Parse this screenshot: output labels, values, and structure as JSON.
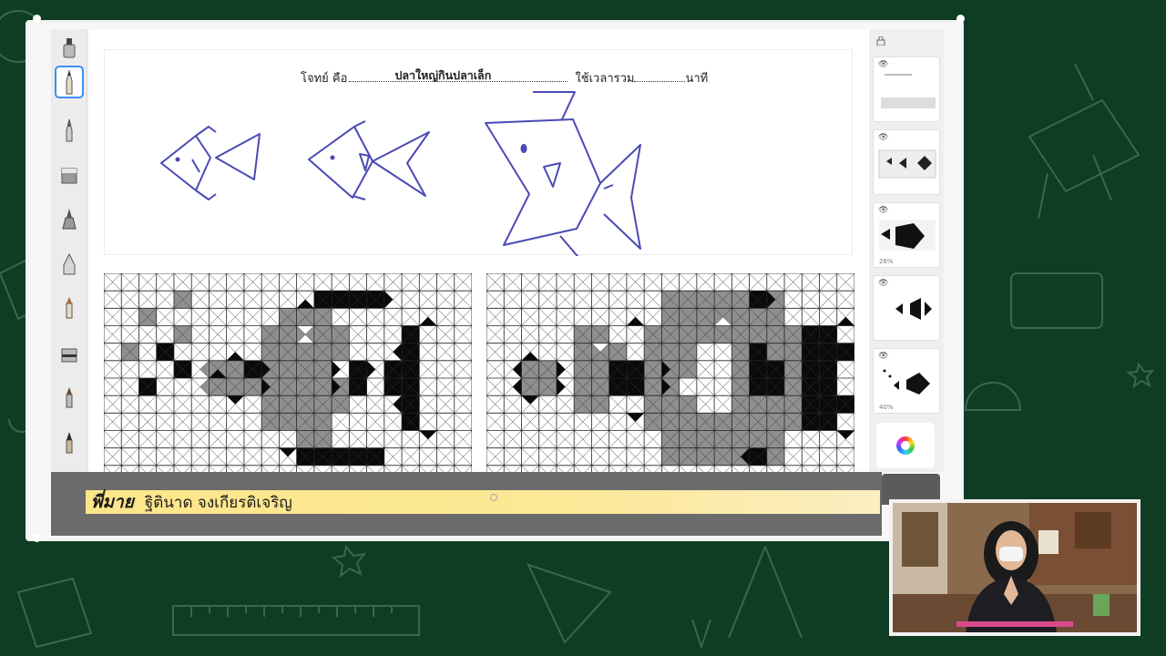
{
  "worksheet": {
    "problem_label": "โจทย์ คือ",
    "problem_answer": "ปลาใหญ่กินปลาเล็ก",
    "time_label": "ใช้เวลารวม",
    "time_unit": "นาที"
  },
  "presenter": {
    "nickname": "พี่มาย",
    "full_name": "ฐิตินาด จงเกียรติเจริญ"
  },
  "toolbar": {
    "tools": [
      "ink-bottle",
      "pencil",
      "pen",
      "eraser",
      "brush",
      "bell-brush",
      "marker",
      "roller",
      "dropper",
      "chisel"
    ],
    "active_tool": "pencil"
  },
  "pages_panel": {
    "thumbnails": [
      {
        "pct": ""
      },
      {
        "pct": ""
      },
      {
        "pct": "26%"
      },
      {
        "pct": ""
      },
      {
        "pct": "40%"
      }
    ]
  },
  "colors": {
    "board": "#0f3d24",
    "sketch_ink": "#4a4ab5",
    "grid_gray": "#8f8f8f",
    "banner": "#fde58a"
  }
}
